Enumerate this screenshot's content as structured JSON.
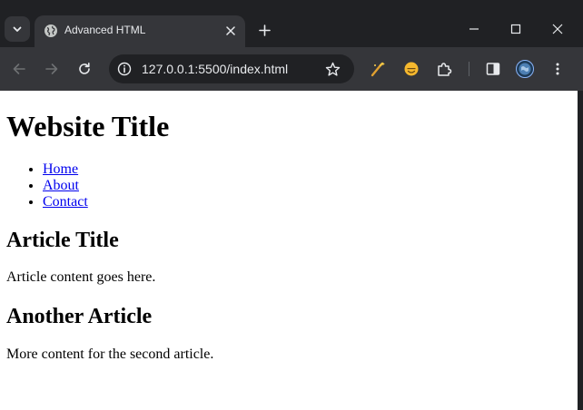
{
  "browser": {
    "tab_title": "Advanced HTML",
    "url": "127.0.0.1:5500/index.html",
    "colors": {
      "frame": "#202124",
      "toolbar": "#35363a",
      "text": "#e8eaed",
      "icon": "#c4c7c5",
      "icon_disabled": "#6e7073"
    },
    "icons": {
      "tab_search": "chevron-down-icon",
      "favicon": "globe-icon",
      "tab_close": "close-icon",
      "new_tab": "plus-icon",
      "minimize": "minimize-icon",
      "maximize": "maximize-icon",
      "close_window": "close-icon",
      "back": "back-arrow-icon",
      "forward": "forward-arrow-icon",
      "reload": "reload-icon",
      "site_info": "info-icon",
      "bookmark": "star-icon",
      "extensions": [
        "magic-wand-icon",
        "emoji-icon",
        "puzzle-icon"
      ],
      "side_panel": "side-panel-icon",
      "profile": "avatar",
      "menu": "more-vert-icon"
    }
  },
  "page": {
    "site_title": "Website Title",
    "nav": [
      {
        "label": "Home"
      },
      {
        "label": "About"
      },
      {
        "label": "Contact"
      }
    ],
    "articles": [
      {
        "title": "Article Title",
        "content": "Article content goes here."
      },
      {
        "title": "Another Article",
        "content": "More content for the second article."
      }
    ],
    "colors": {
      "link": "#0000ee",
      "text": "#000000",
      "background": "#ffffff"
    }
  }
}
